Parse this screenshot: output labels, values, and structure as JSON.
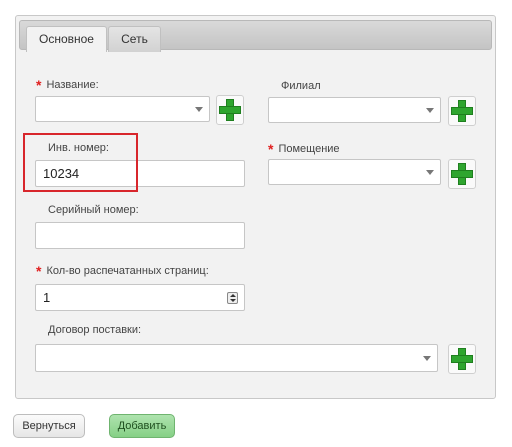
{
  "tabs": [
    {
      "label": "Основное",
      "active": true
    },
    {
      "label": "Сеть",
      "active": false
    }
  ],
  "form": {
    "name": {
      "label": "Название:",
      "required": true,
      "value": ""
    },
    "branch": {
      "label": "Филиал",
      "required": false,
      "value": ""
    },
    "inventory_number": {
      "label": "Инв. номер:",
      "required": false,
      "value": "10234"
    },
    "room": {
      "label": "Помещение",
      "required": true,
      "value": ""
    },
    "serial_number": {
      "label": "Серийный номер:",
      "required": false,
      "value": ""
    },
    "printed_pages": {
      "label": "Кол-во распечатанных страниц:",
      "required": true,
      "value": "1"
    },
    "supply_contract": {
      "label": "Договор поставки:",
      "required": false,
      "value": ""
    }
  },
  "buttons": {
    "back": "Вернуться",
    "add": "Добавить"
  },
  "colors": {
    "required_mark": "#e02020",
    "add_icon": "#2fa52f",
    "highlight": "#d8262c",
    "primary_button": "#86d086"
  }
}
